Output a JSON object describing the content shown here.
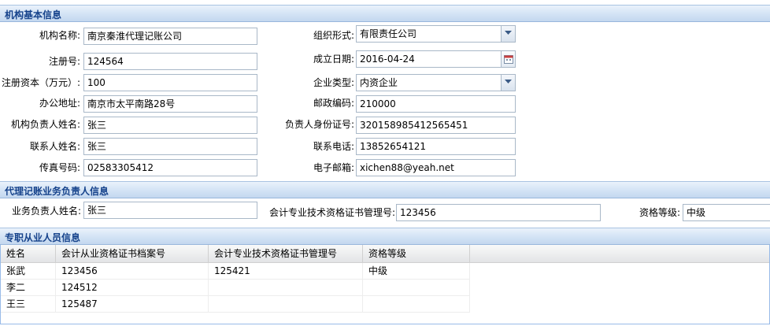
{
  "sections": {
    "basic": "机构基本信息",
    "agent": "代理记账业务负责人信息",
    "staff": "专职从业人员信息"
  },
  "basic": {
    "name_label": "机构名称:",
    "name_value": "南京秦淮代理记账公司",
    "org_form_label": "组织形式:",
    "org_form_value": "有限责任公司",
    "reg_no_label": "注册号:",
    "reg_no_value": "124564",
    "est_date_label": "成立日期:",
    "est_date_value": "2016-04-24",
    "capital_label": "注册资本（万元）:",
    "capital_value": "100",
    "ent_type_label": "企业类型:",
    "ent_type_value": "内资企业",
    "address_label": "办公地址:",
    "address_value": "南京市太平南路28号",
    "postcode_label": "邮政编码:",
    "postcode_value": "210000",
    "head_label": "机构负责人姓名:",
    "head_value": "张三",
    "id_label": "负责人身份证号:",
    "id_value": "320158985412565451",
    "contact_label": "联系人姓名:",
    "contact_value": "张三",
    "phone_label": "联系电话:",
    "phone_value": "13852654121",
    "fax_label": "传真号码:",
    "fax_value": "02583305412",
    "email_label": "电子邮箱:",
    "email_value": "xichen88@yeah.net"
  },
  "agent": {
    "name_label": "业务负责人姓名:",
    "name_value": "张三",
    "cert_label": "会计专业技术资格证书管理号:",
    "cert_value": "123456",
    "level_label": "资格等级:",
    "level_value": "中级"
  },
  "staff": {
    "columns": [
      "姓名",
      "会计从业资格证书档案号",
      "会计专业技术资格证书管理号",
      "资格等级"
    ],
    "rows": [
      [
        "张武",
        "123456",
        "125421",
        "中级"
      ],
      [
        "李二",
        "124512",
        "",
        ""
      ],
      [
        "王三",
        "125487",
        "",
        ""
      ]
    ]
  },
  "colors": {
    "header_text": "#15428b",
    "header_bg": "#d3e3f5",
    "border": "#99bbe8"
  },
  "icons": {
    "combo": "chevron-down-icon",
    "date": "calendar-icon"
  }
}
